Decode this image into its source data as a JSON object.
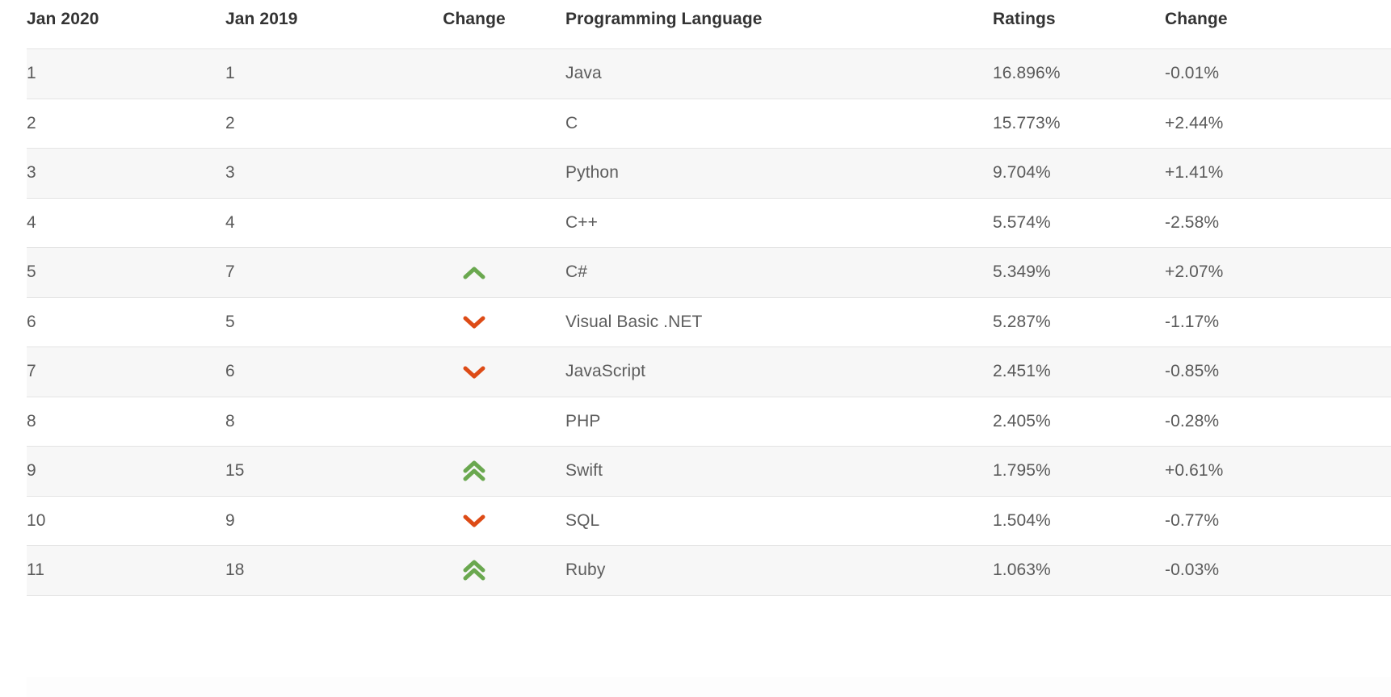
{
  "table": {
    "name": "programming-language-ranking-table",
    "columns": [
      {
        "key": "rank_2020",
        "label": "Jan 2020",
        "align": "left"
      },
      {
        "key": "rank_2019",
        "label": "Jan 2019",
        "align": "left"
      },
      {
        "key": "change_icon",
        "label": "Change",
        "align": "center"
      },
      {
        "key": "language",
        "label": "Programming Language",
        "align": "left"
      },
      {
        "key": "ratings",
        "label": "Ratings",
        "align": "left"
      },
      {
        "key": "change_pct",
        "label": "Change",
        "align": "left"
      }
    ],
    "rows": [
      {
        "rank_2020": "1",
        "rank_2019": "1",
        "change_icon": "none",
        "language": "Java",
        "ratings": "16.896%",
        "change_pct": "-0.01%"
      },
      {
        "rank_2020": "2",
        "rank_2019": "2",
        "change_icon": "none",
        "language": "C",
        "ratings": "15.773%",
        "change_pct": "+2.44%"
      },
      {
        "rank_2020": "3",
        "rank_2019": "3",
        "change_icon": "none",
        "language": "Python",
        "ratings": "9.704%",
        "change_pct": "+1.41%"
      },
      {
        "rank_2020": "4",
        "rank_2019": "4",
        "change_icon": "none",
        "language": "C++",
        "ratings": "5.574%",
        "change_pct": "-2.58%"
      },
      {
        "rank_2020": "5",
        "rank_2019": "7",
        "change_icon": "chevron-up",
        "language": "C#",
        "ratings": "5.349%",
        "change_pct": "+2.07%"
      },
      {
        "rank_2020": "6",
        "rank_2019": "5",
        "change_icon": "chevron-down",
        "language": "Visual Basic .NET",
        "ratings": "5.287%",
        "change_pct": "-1.17%"
      },
      {
        "rank_2020": "7",
        "rank_2019": "6",
        "change_icon": "chevron-down",
        "language": "JavaScript",
        "ratings": "2.451%",
        "change_pct": "-0.85%"
      },
      {
        "rank_2020": "8",
        "rank_2019": "8",
        "change_icon": "none",
        "language": "PHP",
        "ratings": "2.405%",
        "change_pct": "-0.28%"
      },
      {
        "rank_2020": "9",
        "rank_2019": "15",
        "change_icon": "double-chevron-up",
        "language": "Swift",
        "ratings": "1.795%",
        "change_pct": "+0.61%"
      },
      {
        "rank_2020": "10",
        "rank_2019": "9",
        "change_icon": "chevron-down",
        "language": "SQL",
        "ratings": "1.504%",
        "change_pct": "-0.77%"
      },
      {
        "rank_2020": "11",
        "rank_2019": "18",
        "change_icon": "double-chevron-up",
        "language": "Ruby",
        "ratings": "1.063%",
        "change_pct": "-0.03%"
      }
    ]
  },
  "colors": {
    "up": "#6aa84f",
    "down": "#dd4b16",
    "header_text": "#333333",
    "body_text": "#5a5a5a",
    "row_stripe": "#f7f7f7",
    "row_plain": "#ffffff",
    "row_border": "#e4e4e4"
  }
}
